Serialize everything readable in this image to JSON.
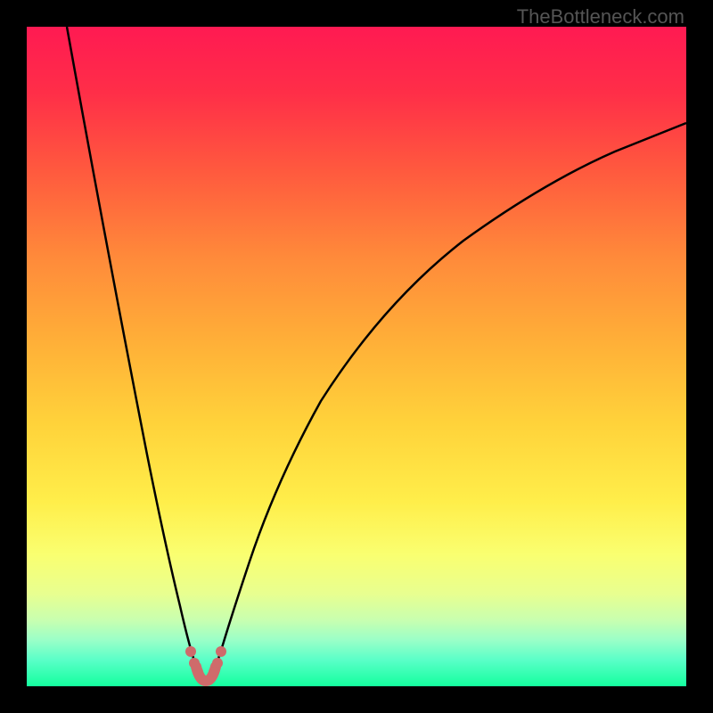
{
  "watermark": "TheBottleneck.com",
  "chart_data": {
    "type": "line",
    "title": "",
    "xlabel": "",
    "ylabel": "",
    "xlim": [
      0,
      100
    ],
    "ylim": [
      0,
      100
    ],
    "background": {
      "type": "vertical-gradient",
      "stops": [
        {
          "pos": 0,
          "color": "#ff1744"
        },
        {
          "pos": 15,
          "color": "#ff3b3b"
        },
        {
          "pos": 35,
          "color": "#ff8a3d"
        },
        {
          "pos": 55,
          "color": "#ffc13d"
        },
        {
          "pos": 72,
          "color": "#ffe83d"
        },
        {
          "pos": 82,
          "color": "#f6ff6b"
        },
        {
          "pos": 88,
          "color": "#d9ff8a"
        },
        {
          "pos": 93,
          "color": "#9dffb0"
        },
        {
          "pos": 97,
          "color": "#4dffb0"
        },
        {
          "pos": 100,
          "color": "#00ff99"
        }
      ]
    },
    "series": [
      {
        "name": "bottleneck-curve",
        "color": "#000000",
        "x": [
          5,
          8,
          11,
          14,
          17,
          20,
          22,
          24,
          25,
          26,
          27,
          28,
          30,
          32,
          35,
          40,
          45,
          50,
          55,
          60,
          65,
          70,
          75,
          80,
          85,
          90,
          95,
          100
        ],
        "y": [
          100,
          85,
          70,
          55,
          40,
          25,
          15,
          6,
          2,
          0,
          0,
          2,
          6,
          12,
          22,
          35,
          45,
          53,
          60,
          66,
          71,
          75,
          78,
          80,
          82,
          83,
          84,
          85
        ]
      }
    ],
    "marker_region": {
      "name": "optimal-zone",
      "color": "#d96b6b",
      "x_range": [
        24,
        28
      ],
      "y_range": [
        0,
        6
      ]
    }
  }
}
